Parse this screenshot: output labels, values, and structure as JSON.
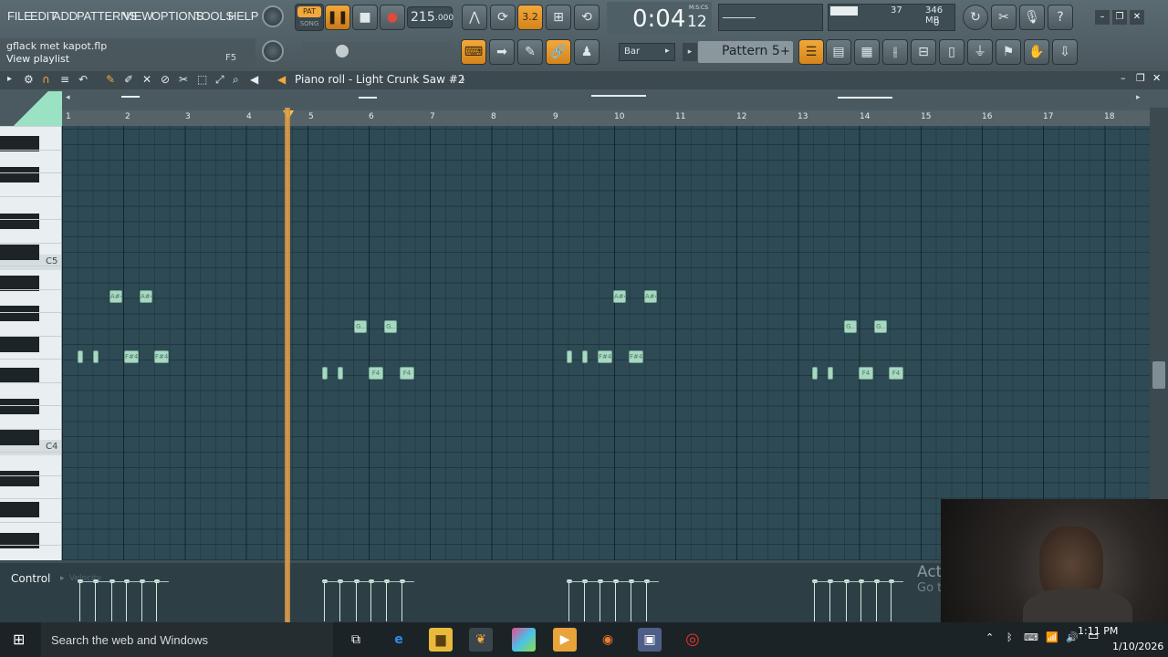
{
  "menu": [
    "FILE",
    "EDIT",
    "ADD",
    "PATTERNS",
    "VIEW",
    "OPTIONS",
    "TOOLS",
    "HELP"
  ],
  "transport": {
    "pat_label": "PAT",
    "song_label": "SONG",
    "tempo": "215",
    "tempo_decimals": ".000"
  },
  "time": {
    "main": "0:04",
    "sub": "12",
    "mode": "M:S:CS"
  },
  "monitor": {
    "value": "37",
    "memory": "346 MB",
    "voices": "0"
  },
  "hint": {
    "filename": "gflack met kapot.flp",
    "text": "View playlist",
    "key": "F5"
  },
  "snap": {
    "value": "Bar"
  },
  "pattern": {
    "name": "Pattern 5",
    "add": "+"
  },
  "pianoroll": {
    "title": "Piano roll - Light Crunk Saw #2",
    "arrow": "›"
  },
  "ruler": [
    "1",
    "2",
    "3",
    "4",
    "5",
    "6",
    "7",
    "8",
    "9",
    "10",
    "11",
    "12",
    "13",
    "14",
    "15",
    "16",
    "17",
    "18"
  ],
  "keys": {
    "c5": "C5",
    "c4": "C4"
  },
  "notes": [
    {
      "label": "A#4"
    },
    {
      "label": "A#4"
    },
    {
      "label": ""
    },
    {
      "label": ""
    },
    {
      "label": "F#4"
    },
    {
      "label": "F#4"
    },
    {
      "label": "G.."
    },
    {
      "label": "G.."
    },
    {
      "label": ""
    },
    {
      "label": ""
    },
    {
      "label": "F4"
    },
    {
      "label": "F4"
    },
    {
      "label": "A#4"
    },
    {
      "label": "A#4"
    },
    {
      "label": ""
    },
    {
      "label": ""
    },
    {
      "label": "F#4"
    },
    {
      "label": "F#4"
    },
    {
      "label": "G.."
    },
    {
      "label": "G.."
    },
    {
      "label": ""
    },
    {
      "label": ""
    },
    {
      "label": "F4"
    },
    {
      "label": "F4"
    }
  ],
  "control": {
    "label": "Control",
    "velocity": "Velocity"
  },
  "watermark": {
    "line1": "Act",
    "line2": "Go t"
  },
  "taskbar": {
    "search": "Search the web and Windows",
    "time": "1:11 PM",
    "date": "1/10/2026"
  },
  "colors": {
    "accent": "#f2a83b",
    "note": "#a9d8c2",
    "grid": "#2e4a55"
  }
}
